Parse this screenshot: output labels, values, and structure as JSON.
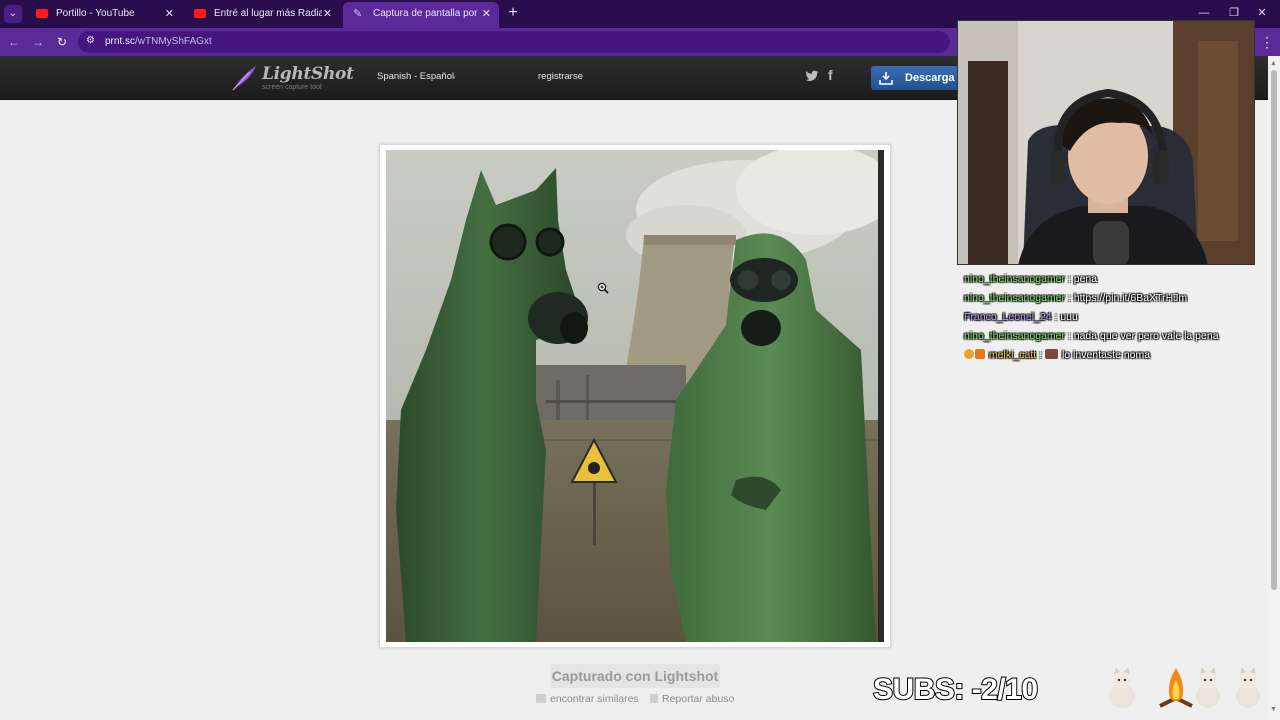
{
  "browser": {
    "tabs": [
      {
        "title": "Portillo - YouTube",
        "favicon": "youtube-icon"
      },
      {
        "title": "Entré al lugar más Radiactivo del",
        "favicon": "youtube-icon"
      },
      {
        "title": "Captura de pantalla por Lightshot",
        "favicon": "lightshot-icon",
        "active": true
      }
    ],
    "url_host": "prnt.sc",
    "url_path": "/wTNMyShFAGxt",
    "accent": "#5a2a99"
  },
  "header": {
    "logo_title": "LightShot",
    "logo_subtitle": "screen capture tool",
    "language": "Spanish - Español",
    "register": "registrarse",
    "download": "Descarga Lightshot gratis"
  },
  "content": {
    "captured_with": "Capturado con Lightshot",
    "find_similar": "encontrar similares",
    "report_abuse": "Reportar abuso"
  },
  "chat": [
    {
      "user": "nino_theinsanogamer",
      "message": ": pena",
      "color": "#7fe36b"
    },
    {
      "user": "nino_theinsanogamer",
      "message": ": https://pin.it/6BaXTrHJm",
      "color": "#7fe36b"
    },
    {
      "user": "Franco_Leonel_24",
      "message": ": uuu",
      "color": "#b79af5"
    },
    {
      "user": "nino_theinsanogamer",
      "message": ": nada que ver pero vale la pena",
      "color": "#7fe36b"
    },
    {
      "user": "melki_catt",
      "message": "lo inventaste noma",
      "color": "#f2c14e",
      "separator": ":"
    }
  ],
  "overlay": {
    "subs_goal": "SUBS: -2/10"
  }
}
